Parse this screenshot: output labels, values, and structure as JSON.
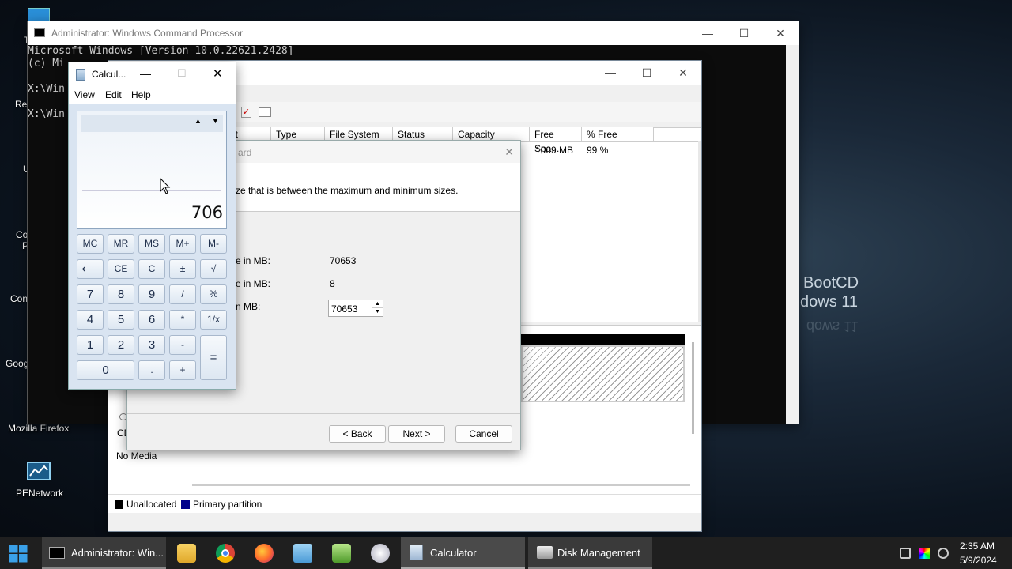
{
  "desktop": {
    "icons": [
      {
        "label": "Mozilla Firefox"
      },
      {
        "label": "PENetwork"
      },
      {
        "label": "Goog"
      },
      {
        "label": "Con"
      },
      {
        "label": "Co"
      },
      {
        "label": "P"
      },
      {
        "label": "U"
      },
      {
        "label": "Re"
      },
      {
        "label": "T"
      }
    ],
    "wallpaper_text": [
      "BootCD",
      "dows 11"
    ],
    "wallpaper_mirror": "dows 11"
  },
  "cmd": {
    "title": "Administrator: Windows Command Processor",
    "lines": [
      "Microsoft Windows [Version 10.0.22621.2428]",
      "(c) Mi",
      "",
      "X:\\Win",
      "",
      "X:\\Win"
    ]
  },
  "disk_mgmt": {
    "columns": [
      "ut",
      "Type",
      "File System",
      "Status",
      "Capacity",
      "Free Spa...",
      "% Free"
    ],
    "row": {
      "free": "1009 MB",
      "pct": "99 %"
    },
    "cd_label": "CD",
    "no_media": "No Media",
    "legend": [
      {
        "label": "Unallocated",
        "color": "#000000"
      },
      {
        "label": "Primary partition",
        "color": "#00008b"
      }
    ]
  },
  "wizard": {
    "title_fragment": "ard",
    "instruction": "ze that is between the maximum and minimum sizes.",
    "fields": [
      {
        "label": "e in MB:",
        "value": "70653"
      },
      {
        "label": "e in MB:",
        "value": "8"
      },
      {
        "label": "n MB:",
        "value": "70653"
      }
    ],
    "buttons": {
      "back": "< Back",
      "next": "Next >",
      "cancel": "Cancel"
    }
  },
  "calculator": {
    "title": "Calcul...",
    "menu": [
      "View",
      "Edit",
      "Help"
    ],
    "display": "706",
    "keys": {
      "row0": [
        "MC",
        "MR",
        "MS",
        "M+",
        "M-"
      ],
      "row1": [
        "⟵",
        "CE",
        "C",
        "±",
        "√"
      ],
      "row2": [
        "7",
        "8",
        "9",
        "/",
        "%"
      ],
      "row3": [
        "4",
        "5",
        "6",
        "*",
        "1/x"
      ],
      "row4": [
        "1",
        "2",
        "3",
        "-"
      ],
      "row5": [
        "0",
        ".",
        "+"
      ],
      "equals": "="
    }
  },
  "taskbar": {
    "items": [
      {
        "label": "Administrator: Win..."
      },
      {
        "label": "Calculator"
      },
      {
        "label": "Disk Management"
      }
    ],
    "time": "2:35 AM",
    "date": "5/9/2024"
  },
  "colors": {
    "taskbar": "#1f1f1f",
    "calc_bg": "#d9e4f1",
    "accent": "#0078d4"
  }
}
